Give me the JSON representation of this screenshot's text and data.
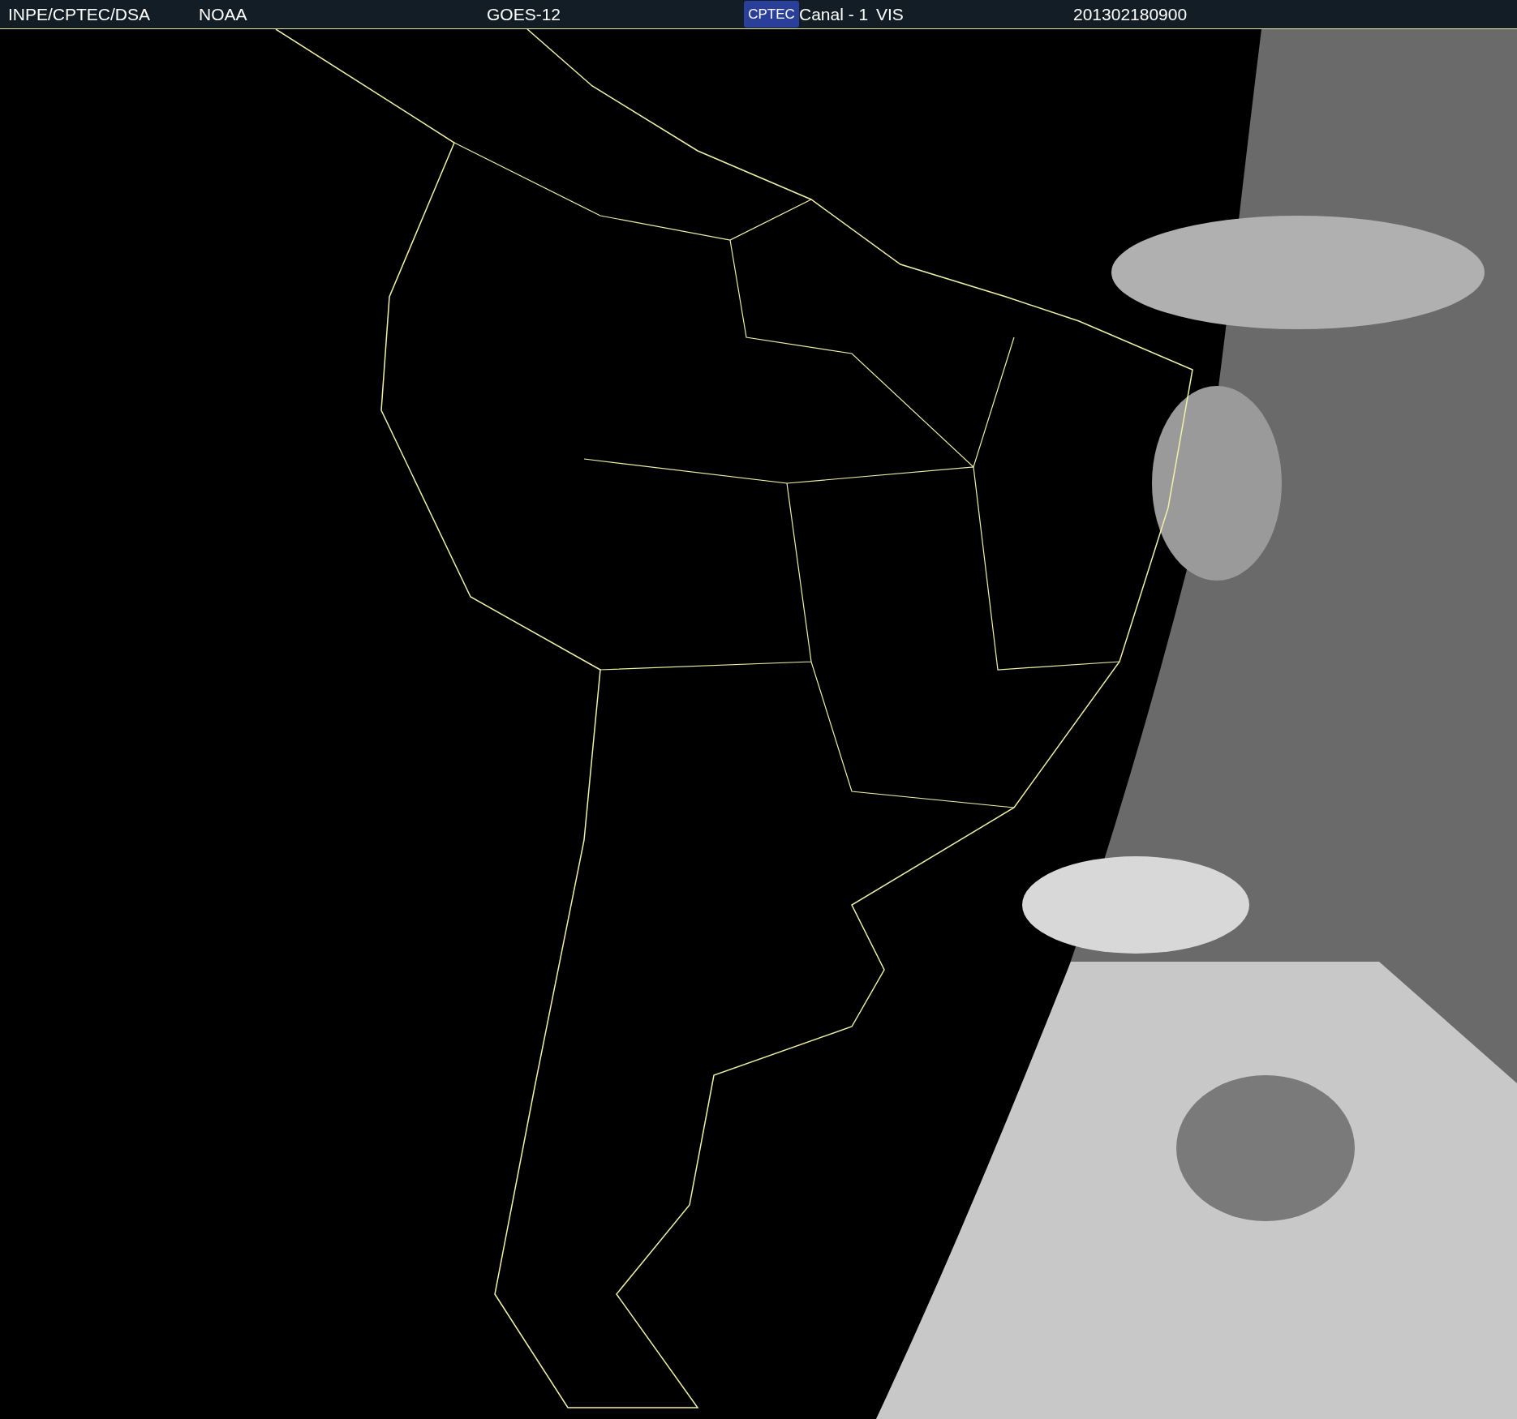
{
  "header": {
    "source": "INPE/CPTEC/DSA",
    "agency": "NOAA",
    "satellite": "GOES-12",
    "logo": "CPTEC",
    "channel": "Canal - 1",
    "band": "VIS",
    "timestamp": "201302180900"
  }
}
